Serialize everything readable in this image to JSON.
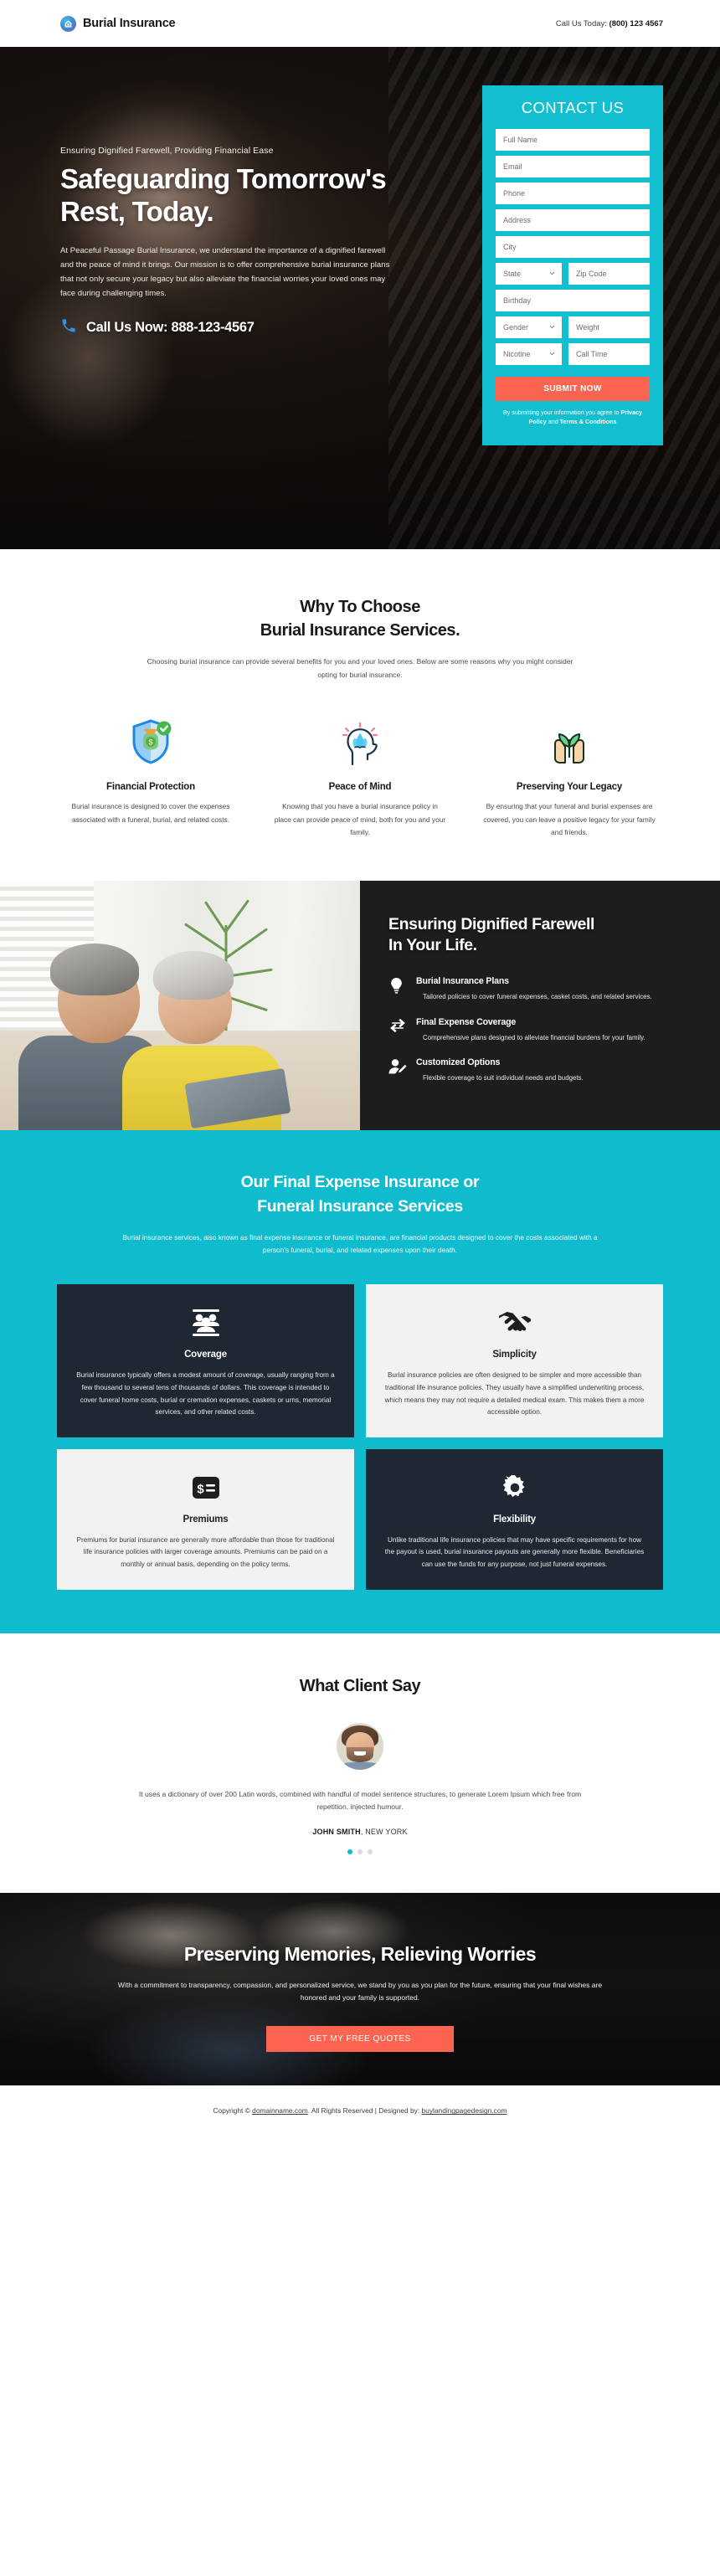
{
  "colors": {
    "teal": "#0fbccd",
    "coral": "#fa6450",
    "dark": "#1d1d1d",
    "card_dark": "#1f2733"
  },
  "topbar": {
    "brand": "Burial Insurance",
    "phone_label": "Call Us Today:",
    "phone_number": "(800) 123 4567"
  },
  "hero": {
    "eyebrow": "Ensuring Dignified Farewell, Providing Financial Ease",
    "title_line1": "Safeguarding Tomorrow's",
    "title_line2": "Rest, Today.",
    "description": "At Peaceful Passage Burial Insurance, we understand the importance of a dignified farewell and the peace of mind it brings. Our mission is to offer comprehensive burial insurance plans that not only secure your legacy but also alleviate the financial worries your loved ones may face during challenging times.",
    "cta_text": "Call Us Now: 888-123-4567"
  },
  "form": {
    "title": "CONTACT US",
    "full_name_placeholder": "Full Name",
    "email_placeholder": "Email",
    "phone_placeholder": "Phone",
    "address_placeholder": "Address",
    "city_placeholder": "City",
    "state_placeholder": "State",
    "zip_placeholder": "Zip Code",
    "birthday_placeholder": "Birthday",
    "gender_placeholder": "Gender",
    "weight_placeholder": "Weight",
    "nicotine_placeholder": "Nicotine",
    "call_time_placeholder": "Call Time",
    "submit_label": "SUBMIT NOW",
    "legal_pre": "By submitting your information you agree to ",
    "legal_privacy": "Privacy Policy",
    "legal_and": " and ",
    "legal_terms": "Terms & Conditions"
  },
  "why": {
    "title_line1": "Why To Choose",
    "title_line2": "Burial Insurance Services.",
    "subtitle": "Choosing burial insurance can provide several benefits for you and your loved ones. Below are some reasons why you might consider opting for burial insurance.",
    "items": [
      {
        "icon": "shield-money-check-icon",
        "title": "Financial Protection",
        "text": "Burial insurance is designed to cover the expenses associated with a funeral, burial, and related costs."
      },
      {
        "icon": "mind-lotus-icon",
        "title": "Peace of Mind",
        "text": "Knowing that you have a burial insurance policy in place can provide peace of mind, both for you and your family."
      },
      {
        "icon": "hands-plant-icon",
        "title": "Preserving Your Legacy",
        "text": "By ensuring that your funeral and burial expenses are covered, you can leave a positive legacy for your family and friends."
      }
    ]
  },
  "split": {
    "title_line1": "Ensuring Dignified Farewell",
    "title_line2": "In Your Life.",
    "features": [
      {
        "icon": "lightbulb-icon",
        "title": "Burial Insurance Plans",
        "text": "Tailored policies to cover funeral expenses, casket costs, and related services."
      },
      {
        "icon": "retweet-icon",
        "title": "Final Expense Coverage",
        "text": "Comprehensive plans designed to alleviate financial burdens for your family."
      },
      {
        "icon": "user-edit-icon",
        "title": "Customized Options",
        "text": "Flexible coverage to suit individual needs and budgets."
      }
    ]
  },
  "services": {
    "title_line1": "Our Final Expense Insurance or",
    "title_line2": "Funeral Insurance Services",
    "subtitle": "Burial insurance services, also known as final expense insurance or funeral insurance, are financial products designed to cover the costs associated with a person's funeral, burial, and related expenses upon their death.",
    "cards": [
      {
        "icon": "users-group-icon",
        "title": "Coverage",
        "text": "Burial insurance typically offers a modest amount of coverage, usually ranging from a few thousand to several tens of thousands of dollars. This coverage is intended to cover funeral home costs, burial or cremation expenses, caskets or urns, memorial services, and other related costs.",
        "theme": "dark"
      },
      {
        "icon": "handshake-icon",
        "title": "Simplicity",
        "text": "Burial insurance policies are often designed to be simpler and more accessible than traditional life insurance policies. They usually have a simplified underwriting process, which means they may not require a detailed medical exam. This makes them a more accessible option.",
        "theme": "light"
      },
      {
        "icon": "money-bill-icon",
        "title": "Premiums",
        "text": "Premiums for burial insurance are generally more affordable than those for traditional life insurance policies with larger coverage amounts. Premiums can be paid on a monthly or annual basis, depending on the policy terms.",
        "theme": "light"
      },
      {
        "icon": "gear-icon",
        "title": "Flexibility",
        "text": "Unlike traditional life insurance policies that may have specific requirements for how the payout is used, burial insurance payouts are generally more flexible. Beneficiaries can use the funds for any purpose, not just funeral expenses.",
        "theme": "dark"
      }
    ]
  },
  "testimonial": {
    "title": "What Client Say",
    "quote": "It uses a dictionary of over 200 Latin words, combined with handful of model sentence structures, to generate Lorem Ipsum which free from repetition, injected humour.",
    "author_name": "JOHN SMITH",
    "author_location": "NEW YORK",
    "dots_total": 3,
    "dots_active": 1
  },
  "cta": {
    "title": "Preserving Memories, Relieving Worries",
    "subtitle": "With a commitment to transparency, compassion, and personalized service, we stand by you as you plan for the future, ensuring that your final wishes are honored and your family is supported.",
    "button_label": "GET MY FREE QUOTES"
  },
  "footer": {
    "copyright_pre": "Copyright © ",
    "domain": "domainname.com",
    "copyright_mid": ". All Rights Reserved | Designed by: ",
    "designer": "buylandingpagedesign.com"
  }
}
